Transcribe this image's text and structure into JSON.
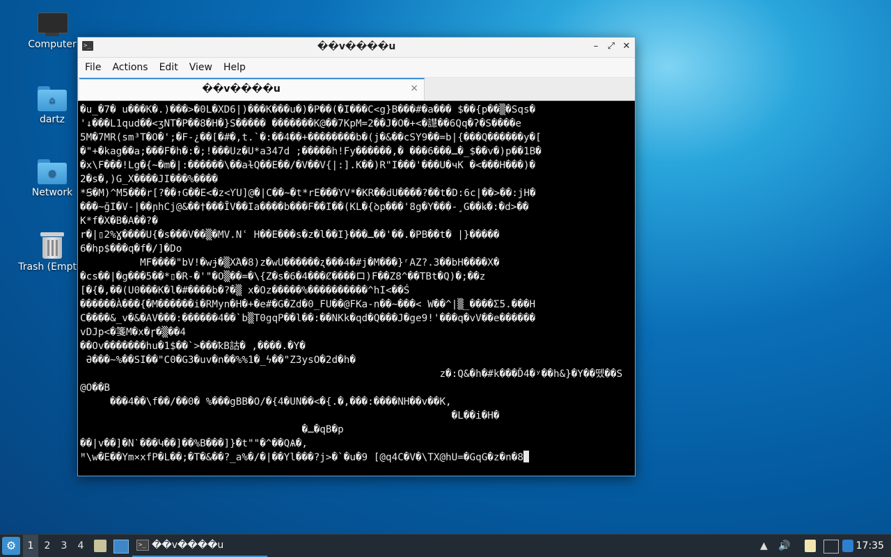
{
  "desktop": {
    "icons": [
      {
        "label": "Computer"
      },
      {
        "label": "dartz"
      },
      {
        "label": "Network"
      },
      {
        "label": "Trash (Empty)"
      }
    ]
  },
  "window": {
    "title": "��v����u",
    "menu": [
      "File",
      "Actions",
      "Edit",
      "View",
      "Help"
    ],
    "tab_label": "��v����u",
    "close_tab_glyph": "×",
    "controls": {
      "minimize": "–",
      "maximize": "⤢",
      "close": "✕"
    }
  },
  "terminal": {
    "lines": [
      "�u_�7� u���K�.)���>�0L�XD6|)���K���u�)�P��(�I���C<g}B���#�a��� $��{p��▒�Sqs�",
      "'↓���L1qud��<ʒNT�P��8�H�}S����� �������K@��7KpM=2��J�O�+<�譿��6Qq�ʔ�S����e",
      "5M�7MR(sm³T�O�';�F-¿��[�#�,t.`�:��4��+��������b�(j�&��cSY9��=b|{���Q������y�[",
      "�\"+�kag��a;���F�h�:�;!���Uz�U*a347d ;�����h!Fy������,� ���6���ـ�_$��v�)p��1B�",
      "�x\\F���!Lg�{~�m�|:������\\��aɫQ��E��/�V��V{|:].K��)R\"I���'���U�чK �<���H���)�",
      "2�s�,)G_X����JI���%����",
      "*Ꞩ�M)^M5���r[?��↑G��E<�z<ƳU]@�|C��~�t*rE���YV*�KR��dU����?��t�D:6c|��>��:jH�",
      "���~ğI�V-|��ɲhCj@&��†���ĪV��Ia����b���F��I��(KL�{ꝺp���'8g�Y���-¸G��ꝃ�:�d>��",
      "K*f�X�B�A��?�",
      "r�|▯2%Ɣ����U{�s���V��▒�MV.Nʿ H��E���s�z�l��I}���ـ��'��.�PB��t� |}�����",
      "6�hp$���q�f�/]�Do",
      "          MF����\"bV!�wɉ�▒XΆ�8)z�wU������ʐ���4�#j�M���}ʳAZ?.3��bH����X�",
      "�cs��|�g���5��*▯�R-�'\"�O▒��=�\\{Z�s�6�4���Ȼ����ロ)F��Z8^��TBt�Q)�;��z",
      "[�{�,��(U0���K�l�#����b�?�▒ x�Oz�����%����������^hI<��Ś",
      "������À���{�M������i�RMyn�H�+�e#�G�Zd�0_FU��@FKa-n��~���< W��^|▒_����Σ5.���H",
      "C����&_v�&�AV���:������4��`b▒T0gqP��l��:��NKk�qd�Q���J�ge9!'���q�vV��e������",
      "vDJp<�箋M�x�ɼ�▒��4",
      "��Ov�������hu�1$��`>���ꝁB詁� ,����.�Y�",
      " Ə���~%��SI��\"C0�G3�uv�n��%%1�_ϟ��\"Z3ysO�2d�h�",
      "                                                            z�:Q&�h�#k���Ď4�ʸ��h&}�Y��뗐��S",
      "@O��B",
      "     ���4��\\f��/��0� %���gBB�O/�{4�UN��<�{.�,���:����NH��v��K,",
      "                                                              �L��i�H�",
      "                                     �ـ�qB�p",
      "��|v��]�Nˋ���Կ��]��%B���]}�t\"\"�^��QѦ�,",
      "ꟸ\\w�E��Ym×xfP�L��;�T�&��?_a%�/�|��Yl���?j>�`�u�9 [@q4C�V�\\TX@hU=�GqG�z�n�8"
    ]
  },
  "taskbar": {
    "workspaces": [
      "1",
      "2",
      "3",
      "4"
    ],
    "active_workspace": "1",
    "task_label": "��v����u",
    "clock": "17:35"
  }
}
